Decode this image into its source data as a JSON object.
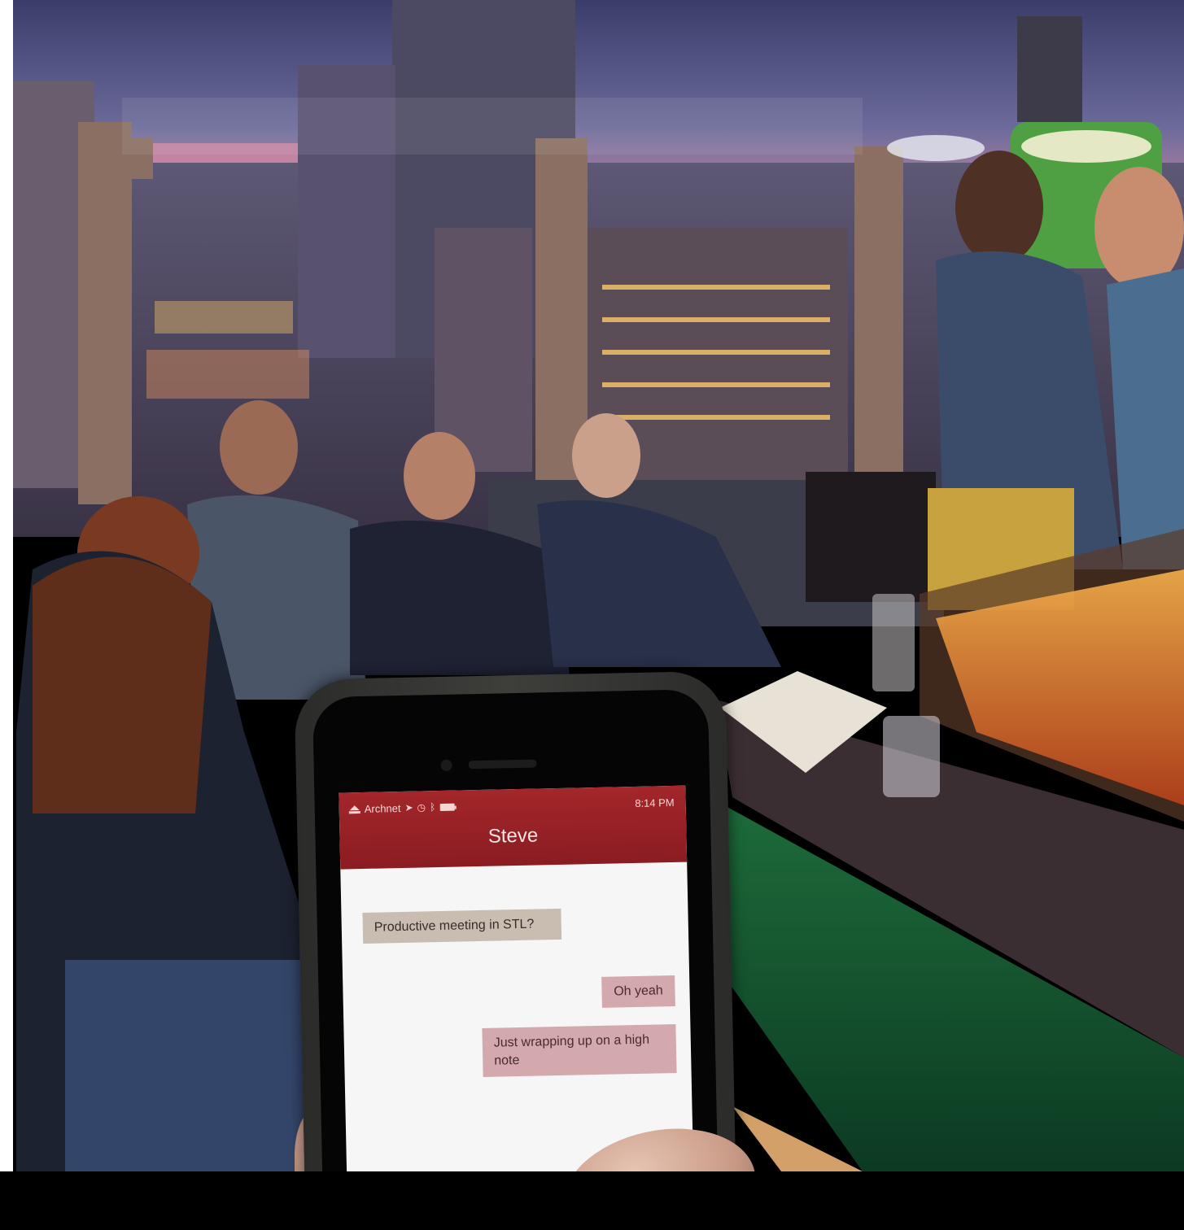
{
  "phone": {
    "status_bar": {
      "carrier": "Archnet",
      "time": "8:14 PM"
    },
    "conversation": {
      "contact_name": "Steve",
      "messages": [
        {
          "direction": "incoming",
          "text": "Productive meeting in STL?"
        },
        {
          "direction": "outgoing",
          "text": "Oh yeah"
        },
        {
          "direction": "outgoing",
          "text": "Just wrapping up on a high note"
        }
      ]
    }
  },
  "colors": {
    "header": "#8a1c22",
    "incoming_bubble": "#c9bdb2",
    "outgoing_bubble": "#d4a9ae"
  }
}
